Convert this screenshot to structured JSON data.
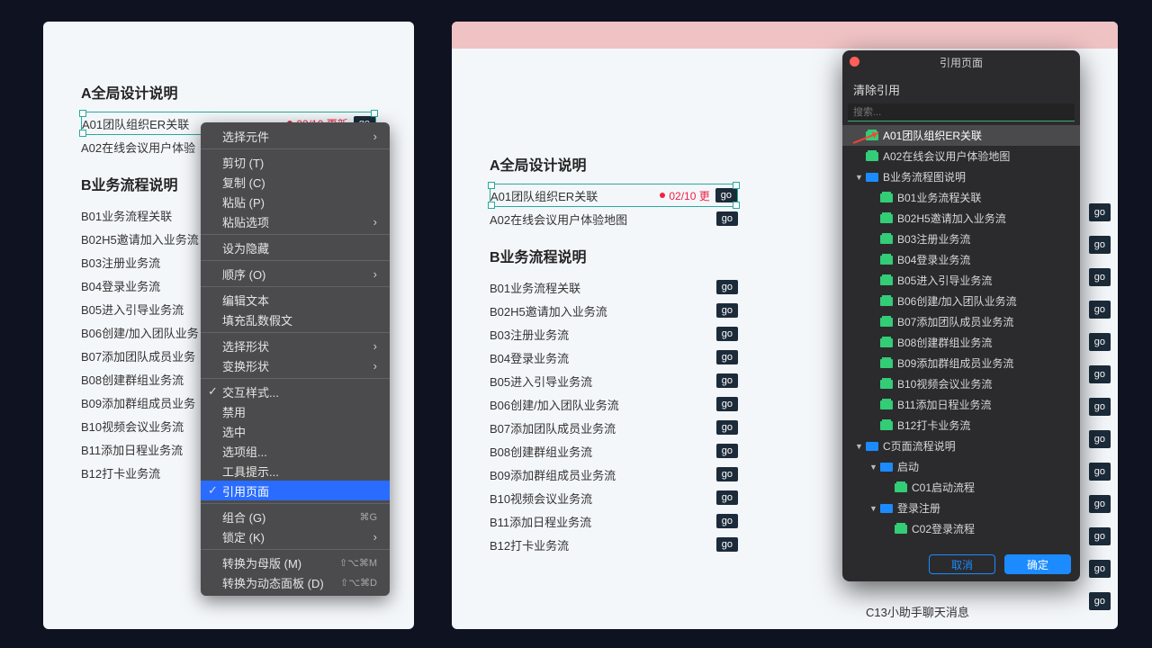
{
  "left": {
    "sectionA": "A全局设计说明",
    "a_items": [
      {
        "label": "A01团队组织ER关联",
        "status": "02/10 更新",
        "selected": true,
        "go": "go"
      },
      {
        "label": "A02在线会议用户体验",
        "go": ""
      }
    ],
    "sectionB": "B业务流程说明",
    "b_items": [
      {
        "label": "B01业务流程关联"
      },
      {
        "label": "B02H5邀请加入业务流"
      },
      {
        "label": "B03注册业务流"
      },
      {
        "label": "B04登录业务流"
      },
      {
        "label": "B05进入引导业务流"
      },
      {
        "label": "B06创建/加入团队业务"
      },
      {
        "label": "B07添加团队成员业务"
      },
      {
        "label": "B08创建群组业务流"
      },
      {
        "label": "B09添加群组成员业务"
      },
      {
        "label": "B10视频会议业务流"
      },
      {
        "label": "B11添加日程业务流"
      },
      {
        "label": "B12打卡业务流"
      }
    ]
  },
  "ctx": {
    "select_components": "选择元件",
    "cut": "剪切 (T)",
    "copy": "复制 (C)",
    "paste": "粘贴 (P)",
    "paste_options": "粘贴选项",
    "set_hidden": "设为隐藏",
    "order": "顺序 (O)",
    "edit_text": "编辑文本",
    "fill_lorem": "填充乱数假文",
    "select_shape": "选择形状",
    "transform_shape": "变换形状",
    "interaction_style": "交互样式...",
    "disable": "禁用",
    "select": "选中",
    "option_group": "选项组...",
    "tooltip": "工具提示...",
    "reference_page": "引用页面",
    "group": "组合 (G)",
    "group_sc": "⌘G",
    "lock": "锁定 (K)",
    "convert_master": "转换为母版 (M)",
    "convert_master_sc": "⇧⌥⌘M",
    "convert_dynamic": "转换为动态面板 (D)",
    "convert_dynamic_sc": "⇧⌥⌘D"
  },
  "right": {
    "sectionA": "A全局设计说明",
    "a_items": [
      {
        "label": "A01团队组织ER关联",
        "status": "02/10 更",
        "selected": true,
        "go": "go"
      },
      {
        "label": "A02在线会议用户体验地图",
        "go": "go"
      }
    ],
    "sectionB": "B业务流程说明",
    "b_items": [
      {
        "label": "B01业务流程关联",
        "go": "go"
      },
      {
        "label": "B02H5邀请加入业务流",
        "go": "go"
      },
      {
        "label": "B03注册业务流",
        "go": "go"
      },
      {
        "label": "B04登录业务流",
        "go": "go"
      },
      {
        "label": "B05进入引导业务流",
        "go": "go"
      },
      {
        "label": "B06创建/加入团队业务流",
        "go": "go"
      },
      {
        "label": "B07添加团队成员业务流",
        "go": "go"
      },
      {
        "label": "B08创建群组业务流",
        "go": "go"
      },
      {
        "label": "B09添加群组成员业务流",
        "go": "go"
      },
      {
        "label": "B10视频会议业务流",
        "go": "go"
      },
      {
        "label": "B11添加日程业务流",
        "go": "go"
      },
      {
        "label": "B12打卡业务流",
        "go": "go"
      }
    ],
    "footer_item": "C13小助手聊天消息"
  },
  "modal": {
    "title": "引用页面",
    "clear": "清除引用",
    "search_placeholder": "搜索...",
    "tree": [
      {
        "depth": 0,
        "type": "page",
        "label": "A01团队组织ER关联",
        "selected": true
      },
      {
        "depth": 0,
        "type": "page",
        "label": "A02在线会议用户体验地图"
      },
      {
        "depth": 0,
        "type": "folder",
        "label": "B业务流程图说明",
        "caret": "▼"
      },
      {
        "depth": 1,
        "type": "page",
        "label": "B01业务流程关联"
      },
      {
        "depth": 1,
        "type": "page",
        "label": "B02H5邀请加入业务流"
      },
      {
        "depth": 1,
        "type": "page",
        "label": "B03注册业务流"
      },
      {
        "depth": 1,
        "type": "page",
        "label": "B04登录业务流"
      },
      {
        "depth": 1,
        "type": "page",
        "label": "B05进入引导业务流"
      },
      {
        "depth": 1,
        "type": "page",
        "label": "B06创建/加入团队业务流"
      },
      {
        "depth": 1,
        "type": "page",
        "label": "B07添加团队成员业务流"
      },
      {
        "depth": 1,
        "type": "page",
        "label": "B08创建群组业务流"
      },
      {
        "depth": 1,
        "type": "page",
        "label": "B09添加群组成员业务流"
      },
      {
        "depth": 1,
        "type": "page",
        "label": "B10视频会议业务流"
      },
      {
        "depth": 1,
        "type": "page",
        "label": "B11添加日程业务流"
      },
      {
        "depth": 1,
        "type": "page",
        "label": "B12打卡业务流"
      },
      {
        "depth": 0,
        "type": "folder",
        "label": "C页面流程说明",
        "caret": "▼"
      },
      {
        "depth": 1,
        "type": "folder",
        "label": "启动",
        "caret": "▼"
      },
      {
        "depth": 2,
        "type": "page",
        "label": "C01启动流程"
      },
      {
        "depth": 1,
        "type": "folder",
        "label": "登录注册",
        "caret": "▼"
      },
      {
        "depth": 2,
        "type": "page",
        "label": "C02登录流程"
      }
    ],
    "cancel": "取消",
    "ok": "确定"
  },
  "go_label": "go"
}
